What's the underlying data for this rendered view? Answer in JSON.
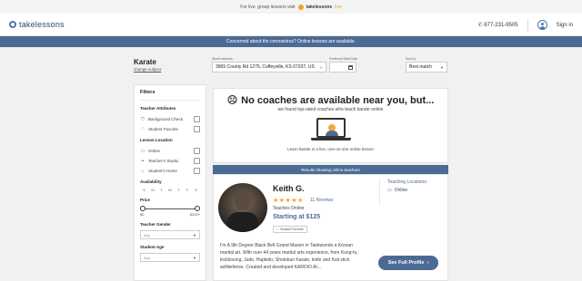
{
  "topbar": {
    "text": "For live, group lessons visit",
    "brand": "takelessons",
    "cta": "live"
  },
  "header": {
    "logo": "takelessons",
    "phone": "877-231-9505",
    "signin": "Sign in"
  },
  "notice": "Concerned about the coronavirus? Online lessons are available.",
  "search": {
    "subject": "Karate",
    "change_subject": "change subject",
    "address_label": "Street address",
    "address_value": "3965 County Rd 1275, Coffeyville, KS 67337, US",
    "date_label": "Preferred Start Date",
    "sort_label": "Sort by",
    "sort_value": "Best match"
  },
  "filters": {
    "title": "Filters",
    "teacher_attributes": "Teacher Attributes",
    "attributes": [
      "Background Check",
      "Student Favorite"
    ],
    "lesson_location": "Lesson Location",
    "locations": [
      "Online",
      "Teacher's Studio",
      "Student's Home"
    ],
    "availability": "Availability",
    "days": [
      "S",
      "M",
      "T",
      "W",
      "T",
      "F",
      "S"
    ],
    "price": "Price",
    "price_min": "$0",
    "price_max": "$200+",
    "gender": "Teacher Gender",
    "gender_value": "Any",
    "age": "Student Age",
    "age_value": "Any"
  },
  "main": {
    "headline": "No coaches are available near you, but...",
    "sub": "we found top-rated coaches who teach karate online",
    "learn": "Learn karate in a live, one-on-one online lesson"
  },
  "results_bar": "Results showing online teachers",
  "teacher": {
    "name": "Keith G.",
    "stars": "★★★★★",
    "reviews": "11 Reviews",
    "teaches": "Teaches Online",
    "price": "Starting at $125",
    "badge": "Student Favorite",
    "locations_title": "Teaching Locations:",
    "location": "Online",
    "bio": "I'm A 9th Degree Black Belt Grand Master  in Taekwondo a Korean martial art. With over 44 years martial arts experience, from Kung-fu, kickboxing, Judo, Hapkido, Shotokan Karate, knife and Kali stick selfdefense. Created and developed KARDIO AI...",
    "button": "See Full Profile"
  }
}
